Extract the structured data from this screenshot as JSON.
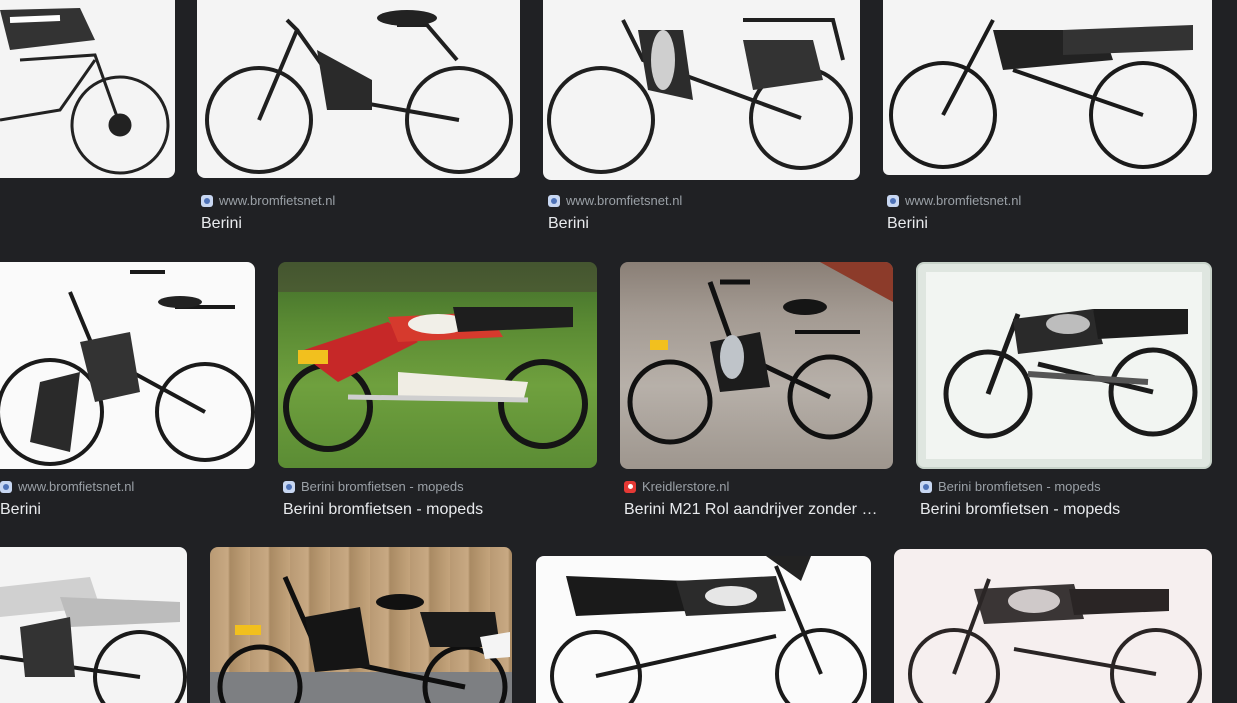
{
  "results": [
    {
      "source": "",
      "title": ""
    },
    {
      "source": "www.bromfietsnet.nl",
      "title": "Berini"
    },
    {
      "source": "www.bromfietsnet.nl",
      "title": "Berini"
    },
    {
      "source": "www.bromfietsnet.nl",
      "title": "Berini"
    },
    {
      "source": "www.bromfietsnet.nl",
      "title": "Berini"
    },
    {
      "source": "Berini bromfietsen - mopeds",
      "title": "Berini bromfietsen - mopeds"
    },
    {
      "source": "Kreidlerstore.nl",
      "title": "Berini M21 Rol aandrijver zonder …"
    },
    {
      "source": "Berini bromfietsen - mopeds",
      "title": "Berini bromfietsen - mopeds"
    }
  ],
  "colors": {
    "background": "#202124",
    "title": "#e8eaed",
    "source": "#9aa0a6",
    "kreidler_favicon": "#e53935"
  }
}
